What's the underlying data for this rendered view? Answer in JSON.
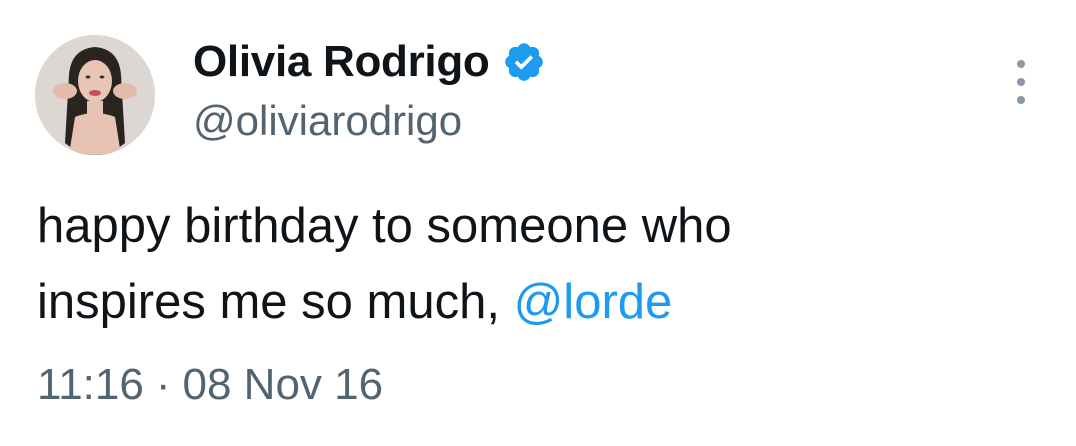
{
  "tweet": {
    "author": {
      "display_name": "Olivia Rodrigo",
      "handle": "@oliviarodrigo",
      "verified": true,
      "verified_color": "#1d9bf0"
    },
    "text_line1": "happy birthday to someone who",
    "text_line2_prefix": "inspires me so much, ",
    "mention": "@lorde",
    "time": "11:16",
    "separator": "·",
    "date": "08 Nov 16"
  },
  "icons": {
    "verified": "verified-badge-icon",
    "more": "more-options-icon"
  },
  "colors": {
    "text": "#0f1419",
    "secondary": "#536471",
    "link": "#1d9bf0"
  }
}
